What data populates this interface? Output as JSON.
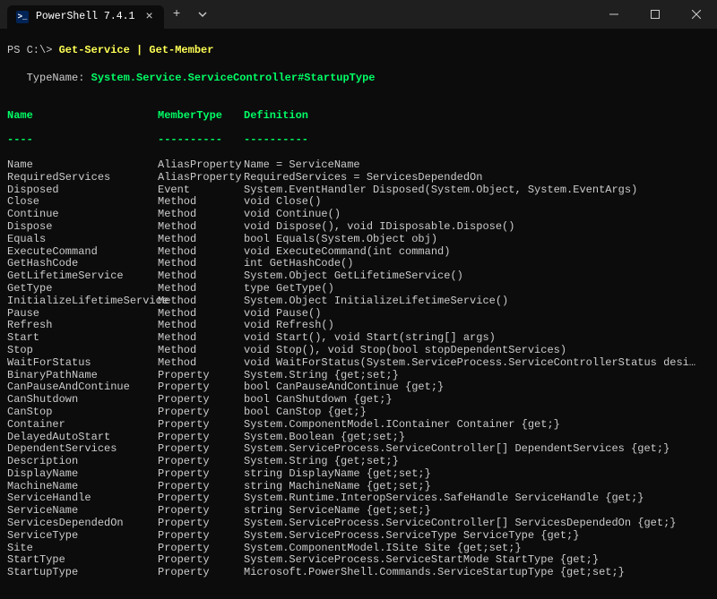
{
  "window": {
    "tab_title": "PowerShell 7.4.1",
    "ps_icon_glyph": ">_"
  },
  "prompt": {
    "prefix": "PS C:\\> ",
    "command": "Get-Service | Get-Member"
  },
  "typename": {
    "label": "   TypeName: ",
    "value": "System.Service.ServiceController#StartupType"
  },
  "headers": {
    "name": "Name",
    "mt": "MemberType",
    "def": "Definition"
  },
  "dashes": {
    "name": "----",
    "mt": "----------",
    "def": "----------"
  },
  "rows": [
    {
      "name": "Name",
      "mt": "AliasProperty",
      "def": "Name = ServiceName"
    },
    {
      "name": "RequiredServices",
      "mt": "AliasProperty",
      "def": "RequiredServices = ServicesDependedOn"
    },
    {
      "name": "Disposed",
      "mt": "Event",
      "def": "System.EventHandler Disposed(System.Object, System.EventArgs)"
    },
    {
      "name": "Close",
      "mt": "Method",
      "def": "void Close()"
    },
    {
      "name": "Continue",
      "mt": "Method",
      "def": "void Continue()"
    },
    {
      "name": "Dispose",
      "mt": "Method",
      "def": "void Dispose(), void IDisposable.Dispose()"
    },
    {
      "name": "Equals",
      "mt": "Method",
      "def": "bool Equals(System.Object obj)"
    },
    {
      "name": "ExecuteCommand",
      "mt": "Method",
      "def": "void ExecuteCommand(int command)"
    },
    {
      "name": "GetHashCode",
      "mt": "Method",
      "def": "int GetHashCode()"
    },
    {
      "name": "GetLifetimeService",
      "mt": "Method",
      "def": "System.Object GetLifetimeService()"
    },
    {
      "name": "GetType",
      "mt": "Method",
      "def": "type GetType()"
    },
    {
      "name": "InitializeLifetimeService",
      "mt": "Method",
      "def": "System.Object InitializeLifetimeService()"
    },
    {
      "name": "Pause",
      "mt": "Method",
      "def": "void Pause()"
    },
    {
      "name": "Refresh",
      "mt": "Method",
      "def": "void Refresh()"
    },
    {
      "name": "Start",
      "mt": "Method",
      "def": "void Start(), void Start(string[] args)"
    },
    {
      "name": "Stop",
      "mt": "Method",
      "def": "void Stop(), void Stop(bool stopDependentServices)"
    },
    {
      "name": "WaitForStatus",
      "mt": "Method",
      "def": "void WaitForStatus(System.ServiceProcess.ServiceControllerStatus desiredStatus…"
    },
    {
      "name": "BinaryPathName",
      "mt": "Property",
      "def": "System.String {get;set;}"
    },
    {
      "name": "CanPauseAndContinue",
      "mt": "Property",
      "def": "bool CanPauseAndContinue {get;}"
    },
    {
      "name": "CanShutdown",
      "mt": "Property",
      "def": "bool CanShutdown {get;}"
    },
    {
      "name": "CanStop",
      "mt": "Property",
      "def": "bool CanStop {get;}"
    },
    {
      "name": "Container",
      "mt": "Property",
      "def": "System.ComponentModel.IContainer Container {get;}"
    },
    {
      "name": "DelayedAutoStart",
      "mt": "Property",
      "def": "System.Boolean {get;set;}"
    },
    {
      "name": "DependentServices",
      "mt": "Property",
      "def": "System.ServiceProcess.ServiceController[] DependentServices {get;}"
    },
    {
      "name": "Description",
      "mt": "Property",
      "def": "System.String {get;set;}"
    },
    {
      "name": "DisplayName",
      "mt": "Property",
      "def": "string DisplayName {get;set;}"
    },
    {
      "name": "MachineName",
      "mt": "Property",
      "def": "string MachineName {get;set;}"
    },
    {
      "name": "ServiceHandle",
      "mt": "Property",
      "def": "System.Runtime.InteropServices.SafeHandle ServiceHandle {get;}"
    },
    {
      "name": "ServiceName",
      "mt": "Property",
      "def": "string ServiceName {get;set;}"
    },
    {
      "name": "ServicesDependedOn",
      "mt": "Property",
      "def": "System.ServiceProcess.ServiceController[] ServicesDependedOn {get;}"
    },
    {
      "name": "ServiceType",
      "mt": "Property",
      "def": "System.ServiceProcess.ServiceType ServiceType {get;}"
    },
    {
      "name": "Site",
      "mt": "Property",
      "def": "System.ComponentModel.ISite Site {get;set;}"
    },
    {
      "name": "StartType",
      "mt": "Property",
      "def": "System.ServiceProcess.ServiceStartMode StartType {get;}"
    },
    {
      "name": "StartupType",
      "mt": "Property",
      "def": "Microsoft.PowerShell.Commands.ServiceStartupType {get;set;}"
    }
  ]
}
